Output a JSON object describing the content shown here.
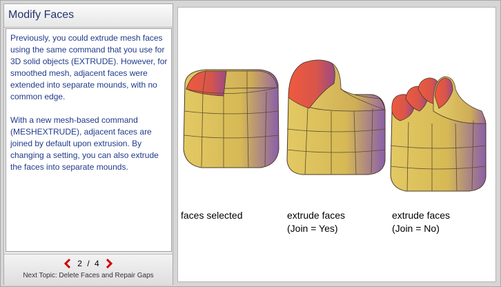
{
  "title": "Modify Faces",
  "body": {
    "paragraph1": "Previously, you could extrude mesh faces using the same command that you use for 3D solid objects (EXTRUDE). However, for smoothed mesh, adjacent faces were extended into separate mounds, with no common edge.",
    "paragraph2": "With a new mesh-based command (MESHEXTRUDE), adjacent faces are joined by default upon extrusion.  By changing a setting, you can also extrude the faces into separate mounds."
  },
  "pager": {
    "current": "2",
    "separator": "/",
    "total": "4",
    "prev_icon": "chevron-left-icon",
    "next_icon": "chevron-right-icon",
    "next_topic": "Next Topic: Delete Faces and Repair Gaps"
  },
  "captions": {
    "first": "faces selected",
    "second": "extrude faces\n(Join = Yes)",
    "third": "extrude faces\n(Join = No)"
  },
  "colors": {
    "title": "#21336e",
    "body_text": "#1f3a8a",
    "arrow": "#d40000",
    "cube_yellow": "#d8bd57",
    "cube_shadow": "#8a5fa8",
    "selected_face": "#e8543c"
  }
}
